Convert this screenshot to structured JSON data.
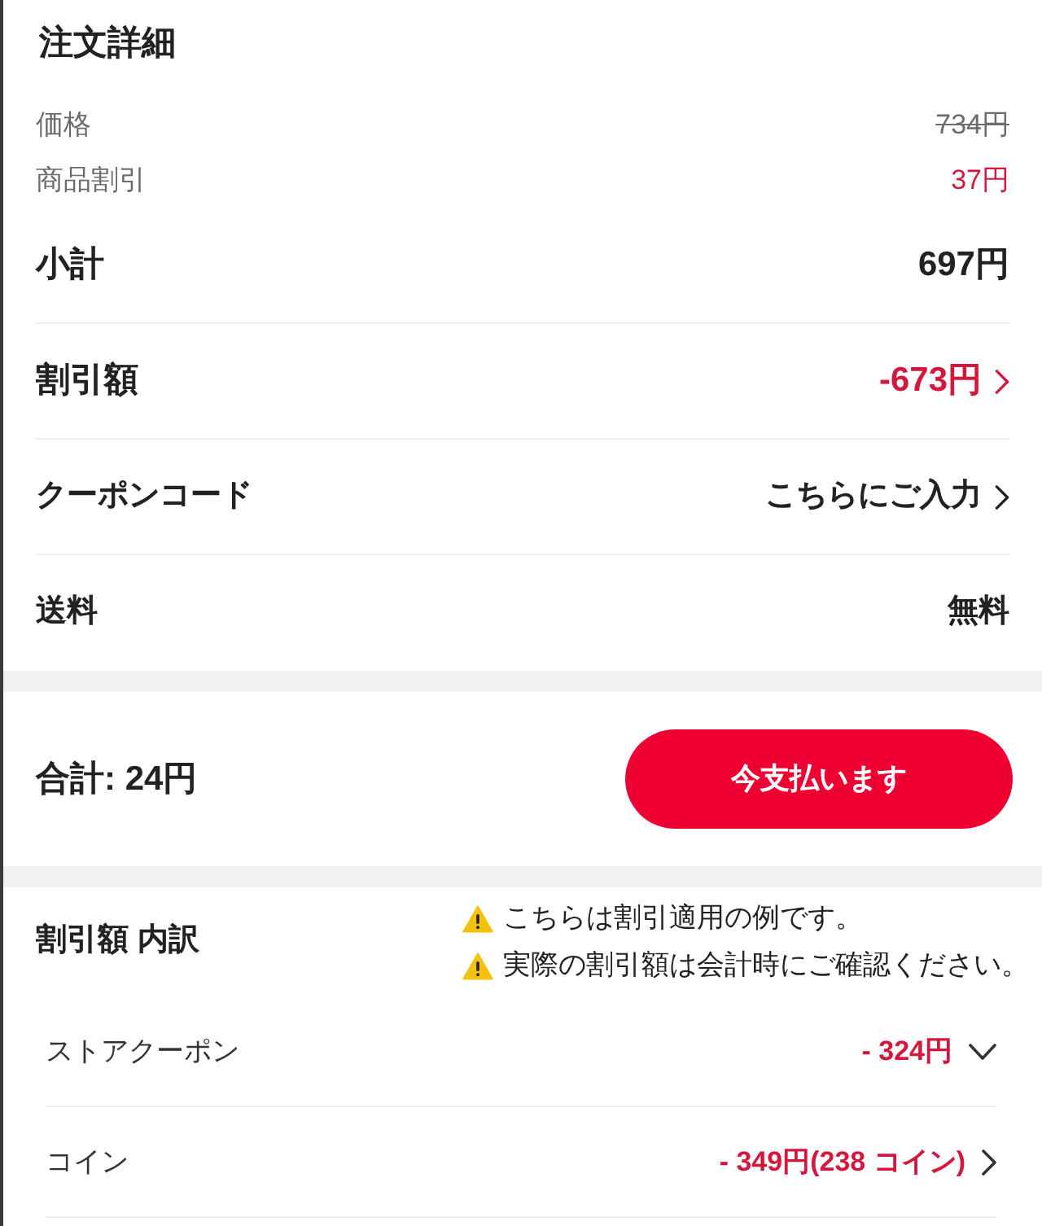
{
  "order_details": {
    "title": "注文詳細",
    "rows": [
      {
        "kind": "original",
        "label": "価格",
        "value": "734円"
      },
      {
        "kind": "discount",
        "label": "商品割引",
        "value": "37円"
      },
      {
        "kind": "subtotal",
        "label": "小計",
        "value": "697円"
      },
      {
        "kind": "reduction",
        "label": "割引額",
        "value": "-673円"
      },
      {
        "kind": "entry",
        "label": "クーポンコード",
        "value": "こちらにご入力"
      },
      {
        "kind": "plain",
        "label": "送料",
        "value": "無料"
      }
    ]
  },
  "payment": {
    "total": "合計: 24円",
    "button": "今支払います"
  },
  "discount_breakdown": {
    "title": "割引額 内訳",
    "notices": [
      "こちらは割引適用の例です。",
      "実際の割引額は会計時にご確認ください。"
    ],
    "rows": [
      {
        "kind": "expandable",
        "label": "ストアクーポン",
        "value": "- 324円"
      },
      {
        "kind": "link",
        "label": "コイン",
        "value": "- 349円(238 コイン)"
      }
    ]
  }
}
